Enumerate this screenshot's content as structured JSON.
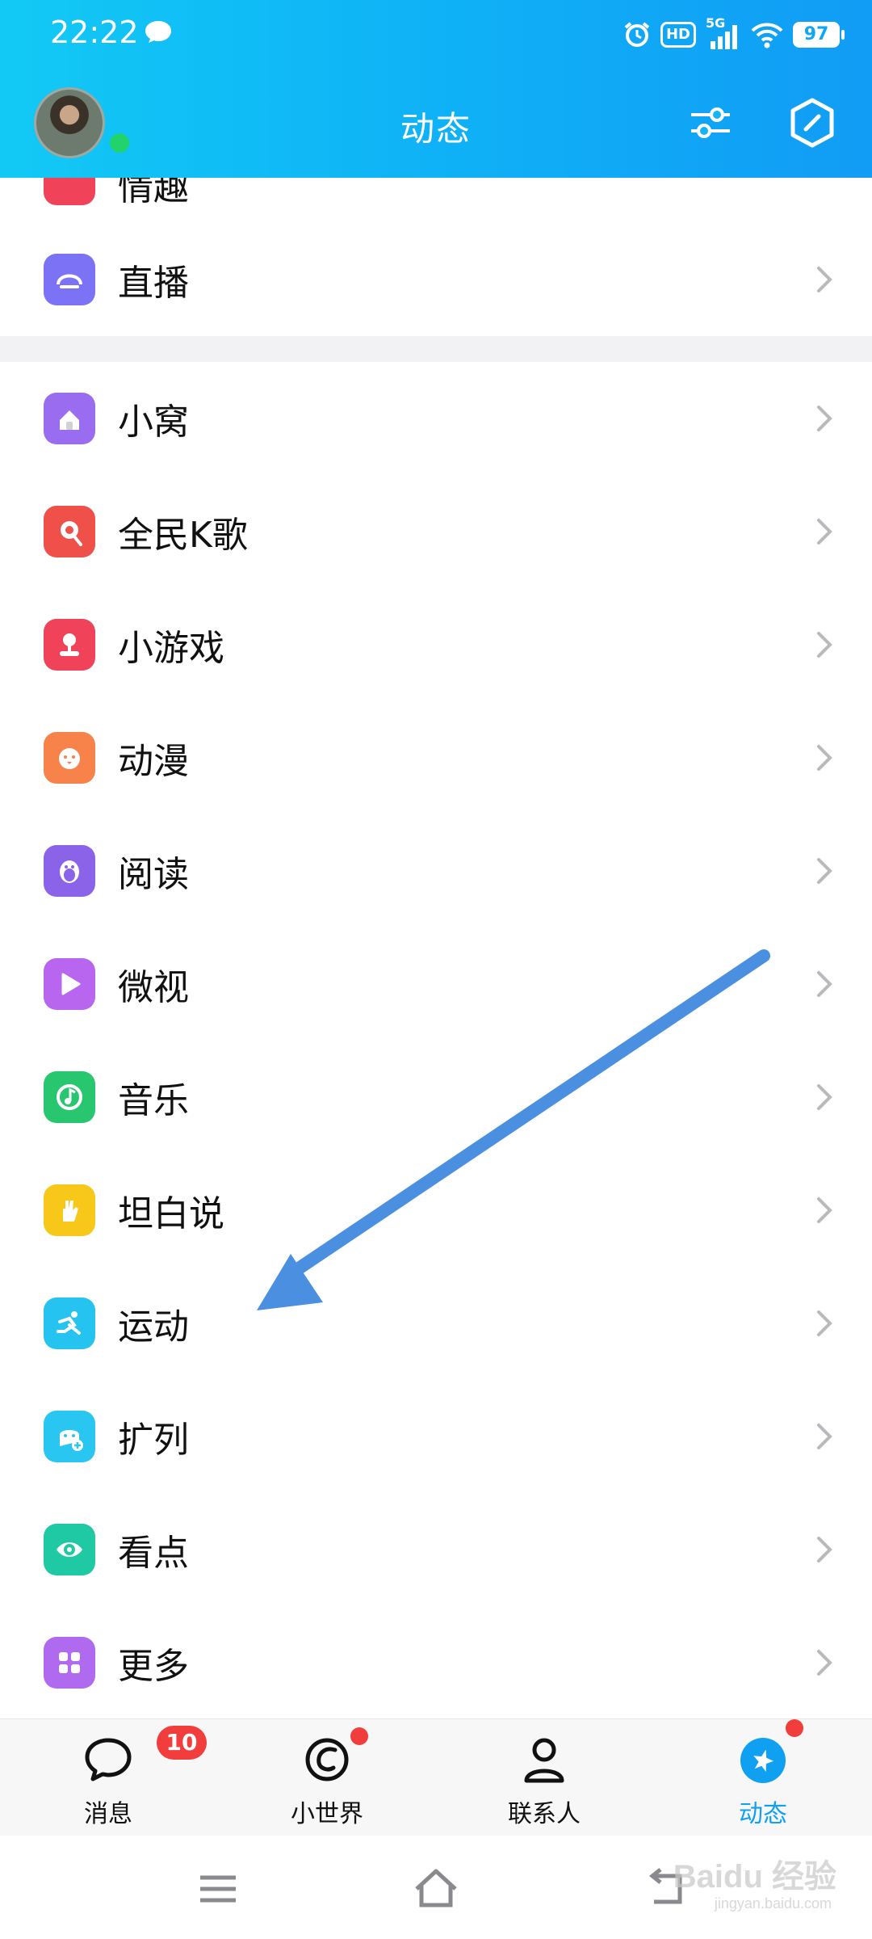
{
  "status_bar": {
    "time": "22:22",
    "network": "5G",
    "hd": "HD",
    "battery": "97"
  },
  "header": {
    "title": "动态",
    "icons": [
      "filter-settings-icon",
      "cube-icon"
    ]
  },
  "partial_item": {
    "label": "情趣"
  },
  "live_item": {
    "label": "直播",
    "color": "#7b72f5"
  },
  "items": [
    {
      "id": "xiaowo",
      "label": "小窝",
      "color": "#9a6cf0",
      "icon": "house-icon"
    },
    {
      "id": "ktv",
      "label": "全民K歌",
      "color": "#f0504a",
      "icon": "karaoke-icon"
    },
    {
      "id": "games",
      "label": "小游戏",
      "color": "#f0435a",
      "icon": "joystick-icon"
    },
    {
      "id": "anime",
      "label": "动漫",
      "color": "#f7824a",
      "icon": "chick-icon"
    },
    {
      "id": "reading",
      "label": "阅读",
      "color": "#8a63e8",
      "icon": "penguin-icon"
    },
    {
      "id": "weishi",
      "label": "微视",
      "color": "#b866f0",
      "icon": "play-icon"
    },
    {
      "id": "music",
      "label": "音乐",
      "color": "#28c76f",
      "icon": "music-note-icon"
    },
    {
      "id": "tanbai",
      "label": "坦白说",
      "color": "#f7c81a",
      "icon": "hand-icon"
    },
    {
      "id": "sport",
      "label": "运动",
      "color": "#25c3f0",
      "icon": "runner-icon"
    },
    {
      "id": "kuolie",
      "label": "扩列",
      "color": "#2ac6f2",
      "icon": "ghost-add-icon"
    },
    {
      "id": "kandian",
      "label": "看点",
      "color": "#1fc9a3",
      "icon": "eye-icon"
    },
    {
      "id": "more",
      "label": "更多",
      "color": "#b06af0",
      "icon": "grid-icon"
    }
  ],
  "tabs": [
    {
      "label": "消息",
      "badge": "10",
      "active": false
    },
    {
      "label": "小世界",
      "badge_dot": true,
      "active": false
    },
    {
      "label": "联系人",
      "active": false
    },
    {
      "label": "动态",
      "badge_dot": true,
      "active": true
    }
  ],
  "colors": {
    "accent": "#0fa0f2",
    "header_start": "#12c9f5",
    "header_end": "#119cf5",
    "annotation_arrow": "#4a8fe0",
    "badge": "#f23d3d"
  },
  "watermark": {
    "text": "Baidu 经验",
    "sub": "jingyan.baidu.com"
  }
}
